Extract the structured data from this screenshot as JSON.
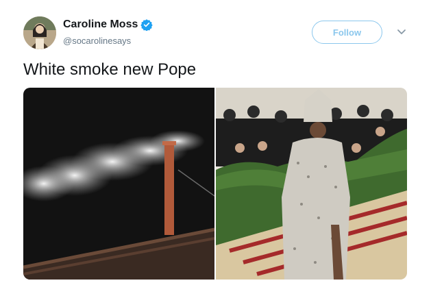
{
  "tweet": {
    "author": {
      "display_name": "Caroline Moss",
      "handle": "@socarolinesays",
      "verified_icon": "verified-badge-icon",
      "avatar": "avatar"
    },
    "follow_label": "Follow",
    "menu_icon": "chevron-down-icon",
    "text": "White smoke new Pope",
    "media": [
      {
        "name": "white-smoke-chimney-photo"
      },
      {
        "name": "met-gala-pope-outfit-photo"
      }
    ]
  },
  "colors": {
    "accent": "#1da1f2",
    "follow_border": "#8bc7ed",
    "text_primary": "#14171a",
    "text_secondary": "#657786"
  }
}
